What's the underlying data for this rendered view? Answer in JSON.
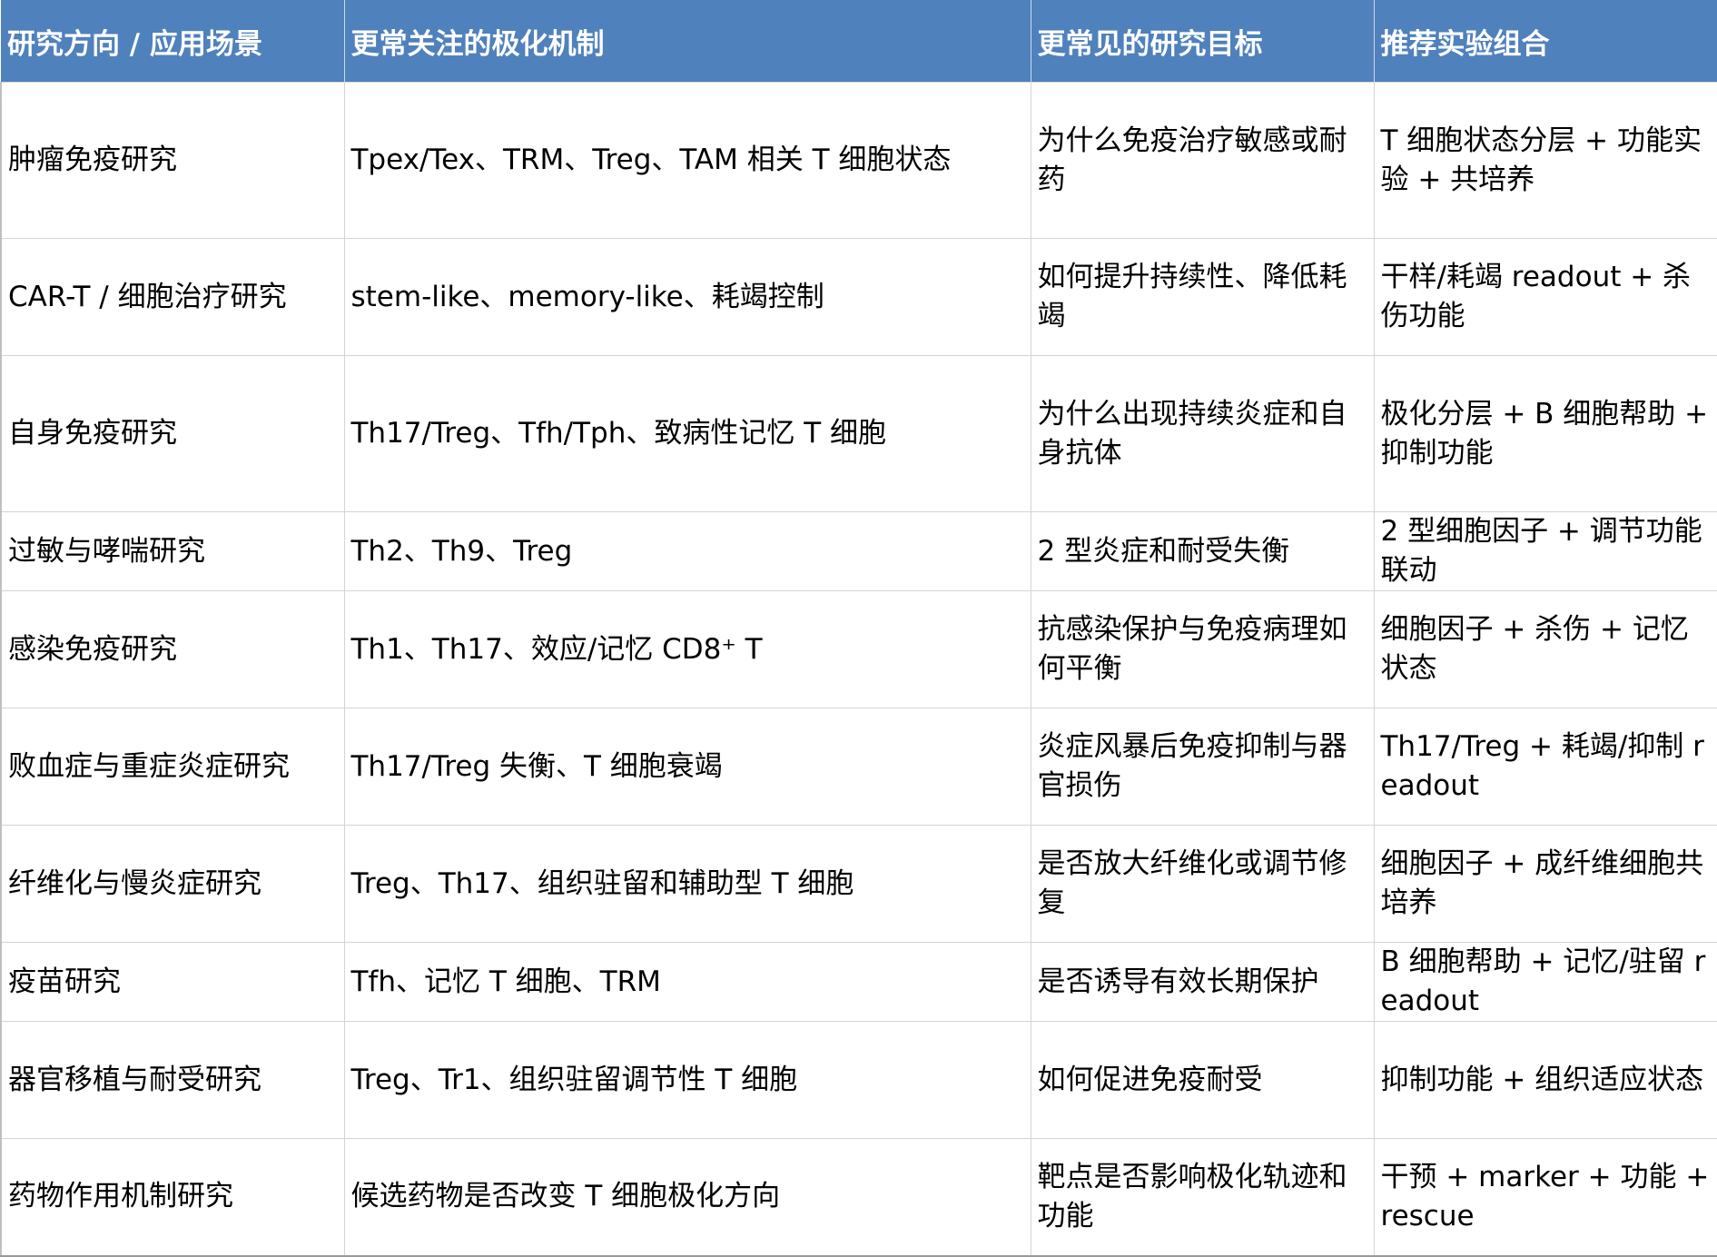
{
  "table": {
    "headers": [
      "研究方向 / 应用场景",
      "更常关注的极化机制",
      "更常见的研究目标",
      "推荐实验组合"
    ],
    "rows": [
      {
        "area": "肿瘤免疫研究",
        "mechanism": "Tpex/Tex、TRM、Treg、TAM 相关 T 细胞状态",
        "goal": "为什么免疫治疗敏感或耐药",
        "combo": "T 细胞状态分层 + 功能实验 + 共培养"
      },
      {
        "area": "CAR-T / 细胞治疗研究",
        "mechanism": "stem-like、memory-like、耗竭控制",
        "goal": "如何提升持续性、降低耗竭",
        "combo": "干样/耗竭 readout + 杀伤功能"
      },
      {
        "area": "自身免疫研究",
        "mechanism": "Th17/Treg、Tfh/Tph、致病性记忆 T 细胞",
        "goal": "为什么出现持续炎症和自身抗体",
        "combo": "极化分层 + B 细胞帮助 + 抑制功能"
      },
      {
        "area": "过敏与哮喘研究",
        "mechanism": "Th2、Th9、Treg",
        "goal": "2 型炎症和耐受失衡",
        "combo": "2 型细胞因子 + 调节功能联动"
      },
      {
        "area": "感染免疫研究",
        "mechanism": "Th1、Th17、效应/记忆 CD8⁺ T",
        "goal": "抗感染保护与免疫病理如何平衡",
        "combo": "细胞因子 + 杀伤 + 记忆状态"
      },
      {
        "area": "败血症与重症炎症研究",
        "mechanism": "Th17/Treg 失衡、T 细胞衰竭",
        "goal": "炎症风暴后免疫抑制与器官损伤",
        "combo": "Th17/Treg + 耗竭/抑制 readout"
      },
      {
        "area": "纤维化与慢炎症研究",
        "mechanism": "Treg、Th17、组织驻留和辅助型 T 细胞",
        "goal": "是否放大纤维化或调节修复",
        "combo": "细胞因子 + 成纤维细胞共培养"
      },
      {
        "area": "疫苗研究",
        "mechanism": "Tfh、记忆 T 细胞、TRM",
        "goal": "是否诱导有效长期保护",
        "combo": "B 细胞帮助 + 记忆/驻留 readout"
      },
      {
        "area": "器官移植与耐受研究",
        "mechanism": "Treg、Tr1、组织驻留调节性 T 细胞",
        "goal": "如何促进免疫耐受",
        "combo": "抑制功能 + 组织适应状态"
      },
      {
        "area": "药物作用机制研究",
        "mechanism": "候选药物是否改变 T 细胞极化方向",
        "goal": "靶点是否影响极化轨迹和功能",
        "combo": "干预 + marker + 功能 + rescue"
      }
    ]
  }
}
